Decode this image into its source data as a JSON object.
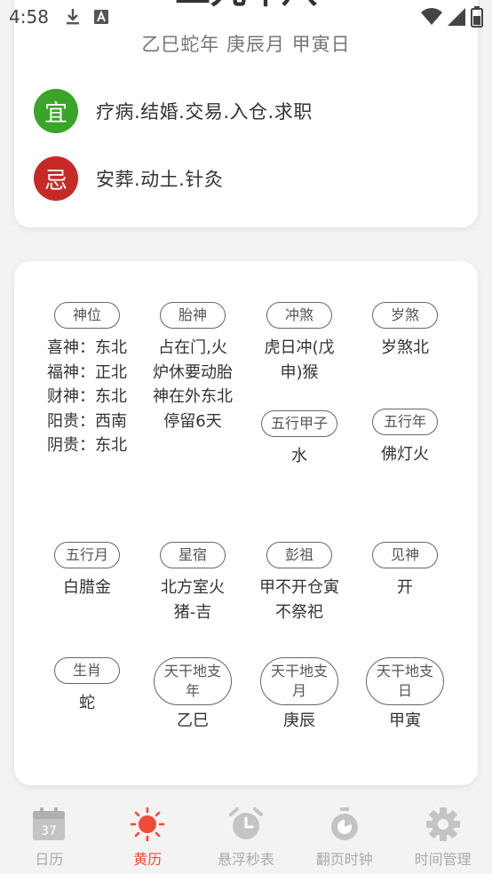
{
  "status_bar": {
    "time": "4:58",
    "icons": [
      "download-icon",
      "a-badge-icon",
      "wifi-icon",
      "signal-icon",
      "battery-icon"
    ]
  },
  "day_card": {
    "big_date_partial": "二九年八",
    "ganzhi": "乙巳蛇年  庚辰月  甲寅日",
    "yi": {
      "badge": "宜",
      "text": "疗病.结婚.交易.入仓.求职",
      "color": "#3aa329"
    },
    "ji": {
      "badge": "忌",
      "text": "安葬.动土.针灸",
      "color": "#c62a27"
    }
  },
  "details": [
    {
      "title": "神位",
      "value": "喜神：东北 福神：正北 财神：东北 阳贵：西南 阴贵：东北"
    },
    {
      "title": "胎神",
      "value": "占在门,火炉休要动胎神在外东北停留6天"
    },
    {
      "title": "冲煞",
      "value": "虎日冲(戊申)猴"
    },
    {
      "title": "岁煞",
      "value": "岁煞北"
    },
    {
      "title": "五行甲子",
      "value": "水"
    },
    {
      "title": "五行年",
      "value": "佛灯火"
    },
    {
      "title": "五行月",
      "value": "白腊金"
    },
    {
      "title": "星宿",
      "value": "北方室火猪-吉"
    },
    {
      "title": "彭祖",
      "value": "甲不开仓寅不祭祀"
    },
    {
      "title": "见神",
      "value": "开"
    },
    {
      "title": "生肖",
      "value": "蛇"
    },
    {
      "title": "天干地支年",
      "value": "乙巳"
    },
    {
      "title": "天干地支月",
      "value": "庚辰"
    },
    {
      "title": "天干地支日",
      "value": "甲寅"
    }
  ],
  "bottom_nav": {
    "active_color": "#f04a3a",
    "items": [
      {
        "label": "日历",
        "icon": "calendar-icon",
        "badge": "37"
      },
      {
        "label": "黄历",
        "icon": "sun-icon"
      },
      {
        "label": "悬浮秒表",
        "icon": "alarm-clock-icon"
      },
      {
        "label": "翻页时钟",
        "icon": "stopwatch-icon"
      },
      {
        "label": "时间管理",
        "icon": "gear-icon"
      }
    ]
  }
}
